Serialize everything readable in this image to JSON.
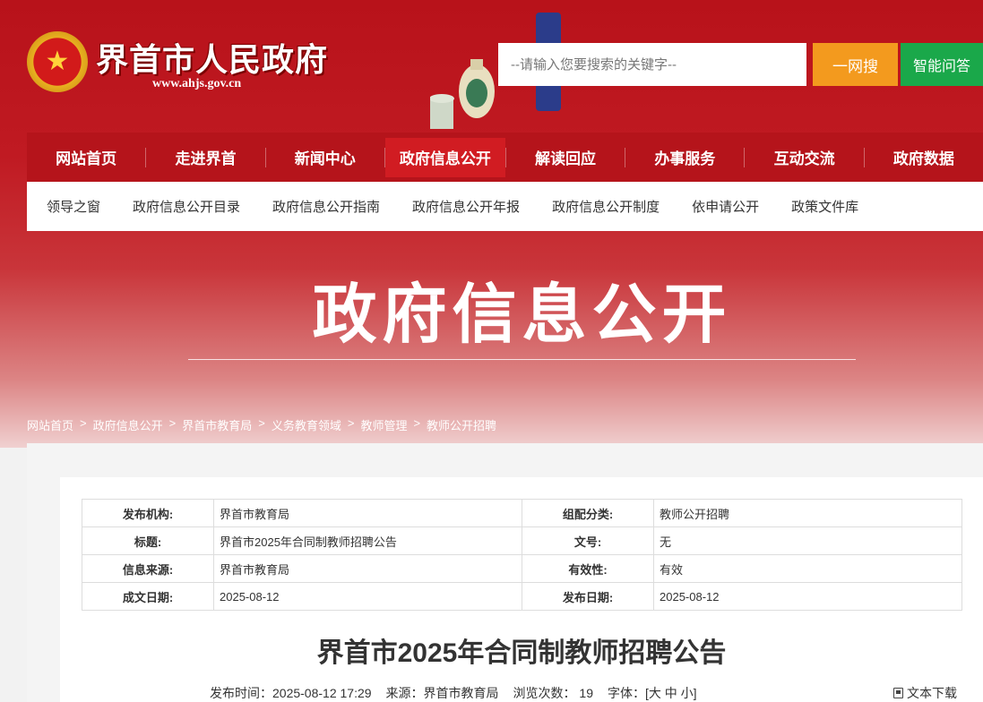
{
  "header": {
    "site_title": "界首市人民政府",
    "site_url": "www.ahjs.gov.cn",
    "search_placeholder": "--请输入您要搜索的关键字--",
    "search_button": "一网搜",
    "ask_button": "智能问答"
  },
  "mainnav": {
    "items": [
      {
        "label": "网站首页"
      },
      {
        "label": "走进界首"
      },
      {
        "label": "新闻中心"
      },
      {
        "label": "政府信息公开",
        "active": true
      },
      {
        "label": "解读回应"
      },
      {
        "label": "办事服务"
      },
      {
        "label": "互动交流"
      },
      {
        "label": "政府数据"
      }
    ]
  },
  "subnav": {
    "items": [
      {
        "label": "领导之窗"
      },
      {
        "label": "政府信息公开目录"
      },
      {
        "label": "政府信息公开指南"
      },
      {
        "label": "政府信息公开年报"
      },
      {
        "label": "政府信息公开制度"
      },
      {
        "label": "依申请公开"
      },
      {
        "label": "政策文件库"
      }
    ]
  },
  "hero": {
    "title": "政府信息公开"
  },
  "breadcrumb": {
    "items": [
      "网站首页",
      "政府信息公开",
      "界首市教育局",
      "义务教育领域",
      "教师管理",
      "教师公开招聘"
    ],
    "separator": ">"
  },
  "meta": {
    "rows": [
      {
        "k1": "发布机构:",
        "v1": "界首市教育局",
        "k2": "组配分类:",
        "v2": "教师公开招聘"
      },
      {
        "k1": "标题:",
        "v1": "界首市2025年合同制教师招聘公告",
        "k2": "文号:",
        "v2": "无"
      },
      {
        "k1": "信息来源:",
        "v1": "界首市教育局",
        "k2": "有效性:",
        "v2": "有效"
      },
      {
        "k1": "成文日期:",
        "v1": "2025-08-12",
        "k2": "发布日期:",
        "v2": "2025-08-12"
      }
    ]
  },
  "document": {
    "title": "界首市2025年合同制教师招聘公告",
    "publish_time": "发布时间：2025-08-12 17:29",
    "source": "来源：界首市教育局",
    "views": "浏览次数：  19",
    "font_size": "字体：[大 中 小]",
    "download": "文本下载"
  },
  "colors": {
    "primary_red": "#b5141b",
    "active_red": "#d11c22",
    "search_orange": "#f39a1e",
    "ask_green": "#1aa84a"
  }
}
